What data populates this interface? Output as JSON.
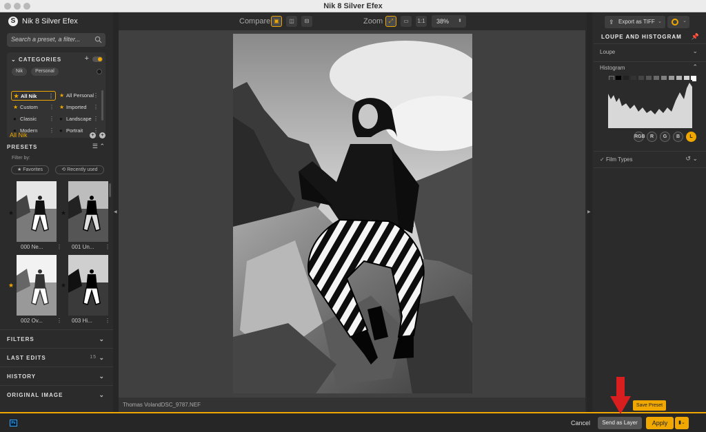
{
  "window": {
    "title": "Nik 8 Silver Efex"
  },
  "left_panel": {
    "app_name": "Nik 8 Silver Efex",
    "search_placeholder": "Search a preset, a filter...",
    "categories": {
      "header": "CATEGORIES",
      "chips": [
        "Nik",
        "Personal"
      ],
      "items": [
        {
          "label": "All Nik",
          "icon": "star",
          "active": true
        },
        {
          "label": "All Personal",
          "icon": "star"
        },
        {
          "label": "Custom",
          "icon": "star"
        },
        {
          "label": "Imported",
          "icon": "star"
        },
        {
          "label": "Classic",
          "icon": "dot"
        },
        {
          "label": "Landscape",
          "icon": "dot"
        },
        {
          "label": "Modern",
          "icon": "dot"
        },
        {
          "label": "Portrait",
          "icon": "dot"
        }
      ]
    },
    "current_category": "All Nik",
    "presets": {
      "header": "PRESETS",
      "filter_by": "Filter by:",
      "filters": [
        "★ Favorites",
        "⟲ Recently used"
      ],
      "thumbnails": [
        {
          "label": "000 Ne...",
          "favorite": false
        },
        {
          "label": "001 Un...",
          "favorite": false
        },
        {
          "label": "002 Ov...",
          "favorite": true
        },
        {
          "label": "003 Hi...",
          "favorite": false
        }
      ]
    },
    "sections": [
      {
        "label": "FILTERS",
        "count": ""
      },
      {
        "label": "LAST EDITS",
        "count": "15"
      },
      {
        "label": "HISTORY",
        "count": ""
      },
      {
        "label": "ORIGINAL IMAGE",
        "count": ""
      }
    ]
  },
  "toolbar": {
    "compare_label": "Compare",
    "zoom_label": "Zoom",
    "zoom_one_to_one": "1:1",
    "zoom_value": "38%"
  },
  "canvas": {
    "filename": "Thomas VolandDSC_9787.NEF"
  },
  "right_panel": {
    "export_label": "Export as TIFF",
    "header": "LOUPE AND HISTOGRAM",
    "loupe_label": "Loupe",
    "histogram_label": "Histogram",
    "channels": [
      "RGB",
      "R",
      "G",
      "B",
      "L"
    ],
    "active_channel": "L",
    "film_types_label": "Film Types",
    "save_preset_label": "Save Preset"
  },
  "bottom_bar": {
    "cancel_label": "Cancel",
    "send_as_layer_label": "Send as Layer",
    "apply_label": "Apply"
  },
  "colors": {
    "accent": "#f0a800",
    "panel": "#2b2b2b",
    "canvas": "#404040",
    "annotation_arrow": "#d81e1e"
  }
}
